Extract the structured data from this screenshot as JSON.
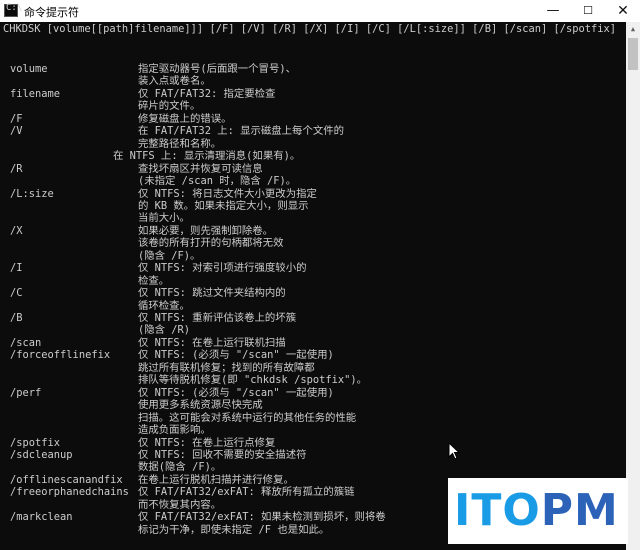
{
  "window": {
    "title": "命令提示符",
    "app_icon_glyph": "C:\\",
    "min_glyph": "—",
    "max_glyph": "☐",
    "close_glyph": "✕"
  },
  "console": {
    "usage": "CHKDSK [volume[[path]filename]]] [/F] [/V] [/R] [/X] [/I] [/C] [/L[:size]] [/B] [/scan] [/spotfix]",
    "rows": [
      {
        "opt": "volume",
        "desc": "指定驱动器号(后面跟一个冒号)、"
      },
      {
        "opt": "",
        "desc": "装入点或卷名。"
      },
      {
        "opt": "filename",
        "desc": "仅 FAT/FAT32: 指定要检查"
      },
      {
        "opt": "",
        "desc": "碎片的文件。"
      },
      {
        "opt": "/F",
        "desc": "修复磁盘上的错误。"
      },
      {
        "opt": "/V",
        "desc": "在 FAT/FAT32 上: 显示磁盘上每个文件的"
      },
      {
        "opt": "",
        "desc": "完整路径和名称。"
      },
      {
        "opt": "",
        "desc": "在 NTFS 上: 显示清理消息(如果有)。",
        "indent2": true
      },
      {
        "opt": "/R",
        "desc": "查找坏扇区并恢复可读信息"
      },
      {
        "opt": "",
        "desc": "(未指定 /scan 时，隐含 /F)。"
      },
      {
        "opt": "/L:size",
        "desc": "仅 NTFS: 将日志文件大小更改为指定"
      },
      {
        "opt": "",
        "desc": "的 KB 数。如果未指定大小，则显示"
      },
      {
        "opt": "",
        "desc": "当前大小。"
      },
      {
        "opt": "/X",
        "desc": "如果必要，则先强制卸除卷。"
      },
      {
        "opt": "",
        "desc": "该卷的所有打开的句柄都将无效"
      },
      {
        "opt": "",
        "desc": "(隐含 /F)。"
      },
      {
        "opt": "/I",
        "desc": "仅 NTFS: 对索引项进行强度较小的"
      },
      {
        "opt": "",
        "desc": "检查。"
      },
      {
        "opt": "/C",
        "desc": "仅 NTFS: 跳过文件夹结构内的"
      },
      {
        "opt": "",
        "desc": "循环检查。"
      },
      {
        "opt": "/B",
        "desc": "仅 NTFS: 重新评估该卷上的坏簇"
      },
      {
        "opt": "",
        "desc": "(隐含 /R)"
      },
      {
        "opt": "/scan",
        "desc": "仅 NTFS: 在卷上运行联机扫描"
      },
      {
        "opt": "/forceofflinefix",
        "desc": "仅 NTFS: (必须与 \"/scan\" 一起使用)"
      },
      {
        "opt": "",
        "desc": "跳过所有联机修复；找到的所有故障都"
      },
      {
        "opt": "",
        "desc": "排队等待脱机修复(即 \"chkdsk /spotfix\")。"
      },
      {
        "opt": "/perf",
        "desc": "仅 NTFS: (必须与 \"/scan\" 一起使用)"
      },
      {
        "opt": "",
        "desc": "使用更多系统资源尽快完成"
      },
      {
        "opt": "",
        "desc": "扫描。这可能会对系统中运行的其他任务的性能"
      },
      {
        "opt": "",
        "desc": "造成负面影响。"
      },
      {
        "opt": "/spotfix",
        "desc": "仅 NTFS: 在卷上运行点修复"
      },
      {
        "opt": "/sdcleanup",
        "desc": "仅 NTFS: 回收不需要的安全描述符"
      },
      {
        "opt": "",
        "desc": "数据(隐含 /F)。"
      },
      {
        "opt": "/offlinescanandfix",
        "desc": "在卷上运行脱机扫描并进行修复。"
      },
      {
        "opt": "/freeorphanedchains",
        "desc": "仅 FAT/FAT32/exFAT: 释放所有孤立的簇链"
      },
      {
        "opt": "",
        "desc": "而不恢复其内容。"
      },
      {
        "opt": "/markclean",
        "desc": "仅 FAT/FAT32/exFAT: 如果未检测到损坏，则将卷"
      },
      {
        "opt": "",
        "desc": "标记为干净，即使未指定 /F 也是如此。"
      }
    ]
  },
  "scrollbar": {
    "up_glyph": "▲"
  },
  "watermark": {
    "part1": "ITO",
    "part2": "PM"
  },
  "colors": {
    "console_bg": "#0c0c0c",
    "console_text": "#cccccc",
    "watermark_light": "#1a9be6",
    "watermark_dark": "#2c63b8"
  }
}
